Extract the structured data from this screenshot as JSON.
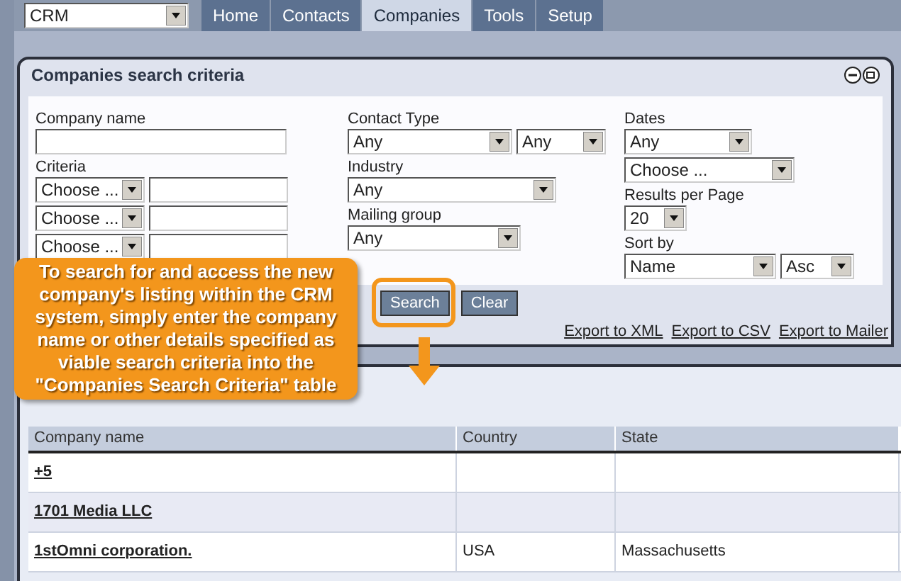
{
  "nav": {
    "app_select": "CRM",
    "tabs": [
      {
        "label": "Home",
        "selected": false
      },
      {
        "label": "Contacts",
        "selected": false
      },
      {
        "label": "Companies",
        "selected": true
      },
      {
        "label": "Tools",
        "selected": false
      },
      {
        "label": "Setup",
        "selected": false
      }
    ]
  },
  "search_criteria": {
    "title": "Companies search criteria",
    "columns": [
      [
        {
          "label": "Company name",
          "controls": [
            {
              "kind": "input"
            }
          ]
        },
        {
          "label": "Criteria",
          "controls": [
            {
              "kind": "criteria",
              "value": "Choose ..."
            },
            {
              "kind": "criteria",
              "value": "Choose ..."
            },
            {
              "kind": "criteria",
              "value": "Choose ..."
            }
          ]
        }
      ],
      [
        {
          "label": "Contact Type",
          "controls": [
            {
              "kind": "select",
              "value": "Any"
            },
            {
              "kind": "select",
              "value": "Any"
            }
          ]
        },
        {
          "label": "Industry",
          "controls": [
            {
              "kind": "select",
              "value": "Any"
            }
          ]
        },
        {
          "label": "Mailing group",
          "controls": [
            {
              "kind": "select",
              "value": "Any"
            }
          ]
        }
      ],
      [
        {
          "label": "Dates",
          "controls": [
            {
              "kind": "select",
              "value": "Any"
            },
            {
              "kind": "select",
              "value": "Choose ..."
            }
          ]
        },
        {
          "label": "Results per Page",
          "controls": [
            {
              "kind": "select",
              "value": "20"
            }
          ]
        },
        {
          "label": "Sort by",
          "controls": [
            {
              "kind": "select",
              "value": "Name"
            },
            {
              "kind": "select",
              "value": "Asc"
            }
          ]
        }
      ]
    ],
    "buttons": [
      "Search",
      "Clear"
    ],
    "export_links": [
      "Export to XML",
      "Export to CSV",
      "Export to Mailer"
    ]
  },
  "callout": {
    "text": "To search for and access the new company's listing within the CRM system, simply enter the company name or other details specified as viable search criteria into the \"Companies Search Criteria\" table"
  },
  "table": {
    "columns": [
      "Company name",
      "Country",
      "State"
    ],
    "rows": [
      {
        "cells": [
          "+5",
          "",
          ""
        ]
      },
      {
        "cells": [
          "1701 Media LLC",
          "",
          ""
        ]
      },
      {
        "cells": [
          "1stOmni corporation.",
          "USA",
          "Massachusetts"
        ]
      }
    ]
  }
}
